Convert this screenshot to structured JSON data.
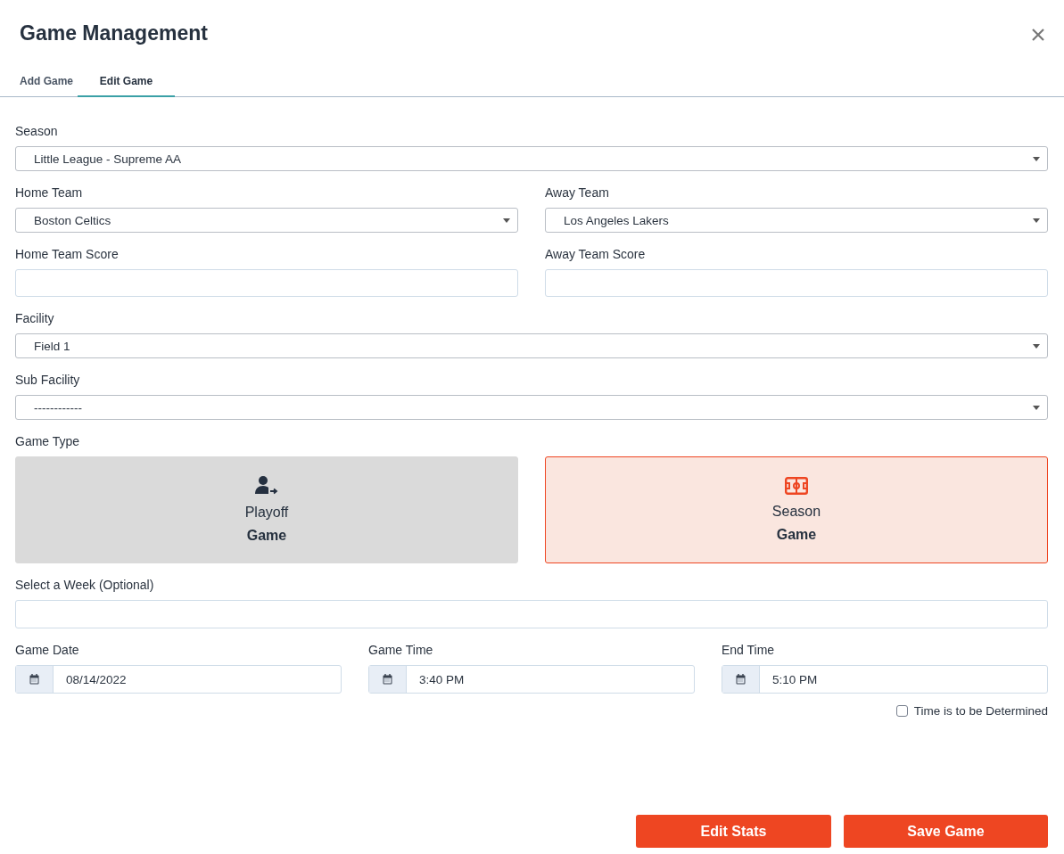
{
  "dialog": {
    "title": "Game Management"
  },
  "tabs": [
    {
      "label": "Add Game",
      "selected": false
    },
    {
      "label": "Edit Game",
      "selected": true
    }
  ],
  "rows": [
    {
      "fields": [
        {
          "kind": "select",
          "label": "Season",
          "value": "Little League - Supreme AA"
        }
      ]
    },
    {
      "fields": [
        {
          "kind": "select",
          "label": "Home Team",
          "value": "Boston Celtics"
        },
        {
          "kind": "select",
          "label": "Away Team",
          "value": "Los Angeles Lakers"
        }
      ]
    },
    {
      "fields": [
        {
          "kind": "text",
          "label": "Home Team Score"
        },
        {
          "kind": "text",
          "label": "Away Team Score"
        }
      ]
    },
    {
      "fields": [
        {
          "kind": "select",
          "label": "Facility",
          "value": "Field 1"
        }
      ]
    },
    {
      "fields": [
        {
          "kind": "select",
          "label": "Sub Facility",
          "value": "------------"
        }
      ]
    }
  ],
  "game_type": {
    "label": "Game Type",
    "options": [
      {
        "kind": "playoff",
        "line1": "Playoff",
        "line2": "Game",
        "selected": false
      },
      {
        "kind": "season",
        "line1": "Season",
        "line2": "Game",
        "selected": true
      }
    ]
  },
  "week": {
    "label": "Select a Week (Optional)"
  },
  "schedule": [
    {
      "label": "Game Date",
      "value": "08/14/2022"
    },
    {
      "label": "Game Time",
      "value": "3:40 PM"
    },
    {
      "label": "End Time",
      "value": "5:10 PM"
    }
  ],
  "tbd": {
    "label": "Time is to be Determined",
    "checked": false
  },
  "buttons": [
    "Edit Stats",
    "Save Game"
  ]
}
